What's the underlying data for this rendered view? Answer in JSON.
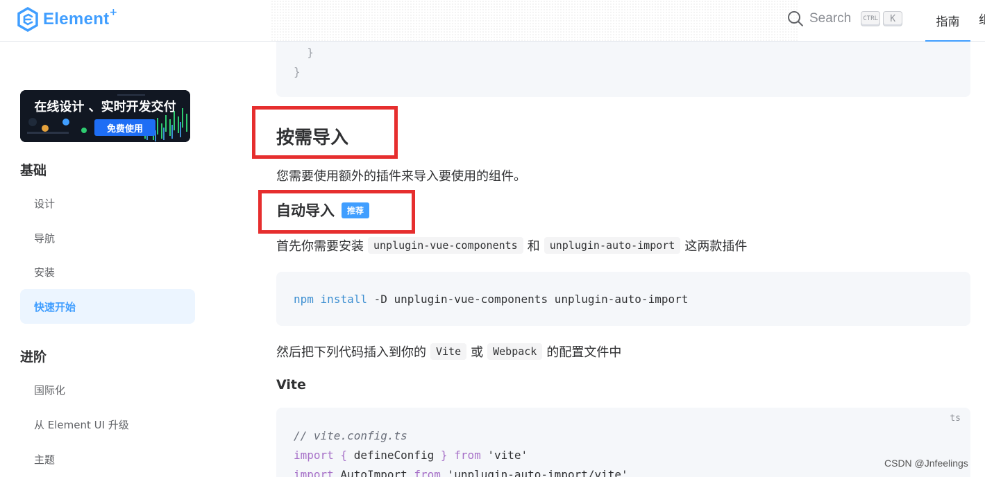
{
  "header": {
    "logo_text": "Element",
    "logo_plus": "+",
    "search_label": "Search",
    "kbd_ctrl": "CTRL",
    "kbd_k": "K",
    "nav_guide": "指南",
    "nav_next_partial": "组",
    "accent": "#409eff"
  },
  "sidebar": {
    "banner_title": "在线设计 、实时开发交付",
    "banner_button": "免费使用",
    "sections": [
      {
        "title": "基础",
        "items": [
          "设计",
          "导航",
          "安装",
          "快速开始"
        ]
      },
      {
        "title": "进阶",
        "items": [
          "国际化",
          "从 Element UI 升级",
          "主题"
        ]
      }
    ],
    "active_item": "快速开始"
  },
  "main": {
    "top_code": [
      "  }",
      "}"
    ],
    "heading_on_demand": "按需导入",
    "para_plugins": "您需要使用额外的插件来导入要使用的组件。",
    "heading_auto": "自动导入",
    "badge_recommended": "推荐",
    "install_text": {
      "before": "首先你需要安装",
      "pkg1": "unplugin-vue-components",
      "and": "和",
      "pkg2": "unplugin-auto-import",
      "after": "这两款插件"
    },
    "install_cmd": {
      "npm": "npm",
      "install": "install",
      "rest": " -D unplugin-vue-components unplugin-auto-import"
    },
    "config_text": {
      "before": "然后把下列代码插入到你的",
      "vite": "Vite",
      "or": "或",
      "webpack": "Webpack",
      "after": "的配置文件中"
    },
    "heading_vite": "Vite",
    "code_lang": "ts",
    "vite_code": {
      "comment": "// vite.config.ts",
      "l2_import": "import",
      "l2_brace_open": " { ",
      "l2_name": "defineConfig",
      "l2_brace_close": " } ",
      "l2_from": "from",
      "l2_src": " 'vite'",
      "l3_import": "import",
      "l3_name": " AutoImport ",
      "l3_from": "from",
      "l3_src": " 'unplugin-auto-import/vite'"
    }
  },
  "watermark": "CSDN @Jnfeelings"
}
